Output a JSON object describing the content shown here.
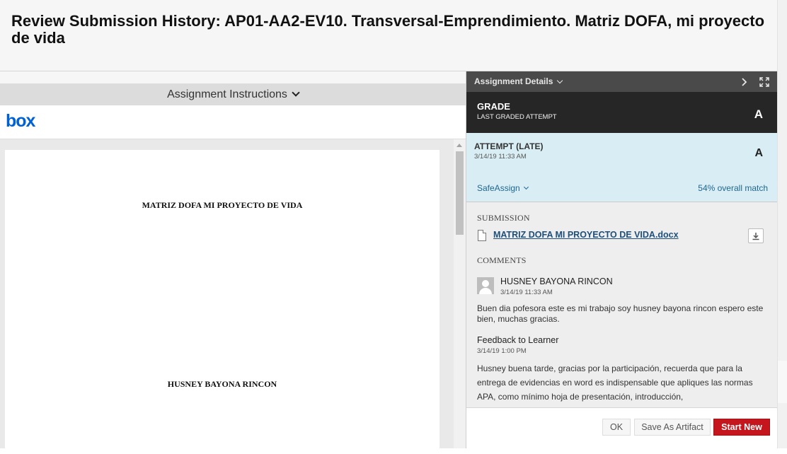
{
  "page": {
    "title": "Review Submission History: AP01-AA2-EV10. Transversal-Emprendimiento. Matriz DOFA, mi proyecto de vida"
  },
  "left": {
    "instructions_label": "Assignment Instructions",
    "viewer_logo": "box",
    "document": {
      "line1": "MATRIZ DOFA MI PROYECTO DE VIDA",
      "line2": "HUSNEY BAYONA RINCON"
    }
  },
  "details": {
    "header_label": "Assignment Details",
    "grade": {
      "title": "GRADE",
      "subtitle": "LAST GRADED ATTEMPT",
      "value": "A"
    },
    "attempt": {
      "title": "ATTEMPT (LATE)",
      "date": "3/14/19 11:33 AM",
      "value": "A",
      "safeassign_label": "SafeAssign",
      "match": "54% overall match"
    },
    "submission": {
      "label": "SUBMISSION",
      "file_name": "MATRIZ DOFA MI PROYECTO DE VIDA.docx"
    },
    "comments": {
      "label": "COMMENTS",
      "author": "HUSNEY BAYONA RINCON",
      "date": "3/14/19 11:33 AM",
      "text": "Buen dia pofesora este es mi trabajo soy husney bayona rincon espero este bien, muchas gracias."
    },
    "feedback": {
      "title": "Feedback to Learner",
      "date": "3/14/19 1:00 PM",
      "text": "Husney buena tarde, gracias por la participación, recuerda que para la entrega de evidencias en word es indispensable que apliques las normas APA, como mínimo hoja de presentación, introducción,"
    },
    "buttons": {
      "ok": "OK",
      "save_artifact": "Save As Artifact",
      "start_new": "Start New"
    }
  },
  "colors": {
    "accent_red": "#c4161c",
    "link_blue": "#1f6691",
    "box_blue": "#0061d5",
    "attempt_bg": "#d9eef4"
  }
}
